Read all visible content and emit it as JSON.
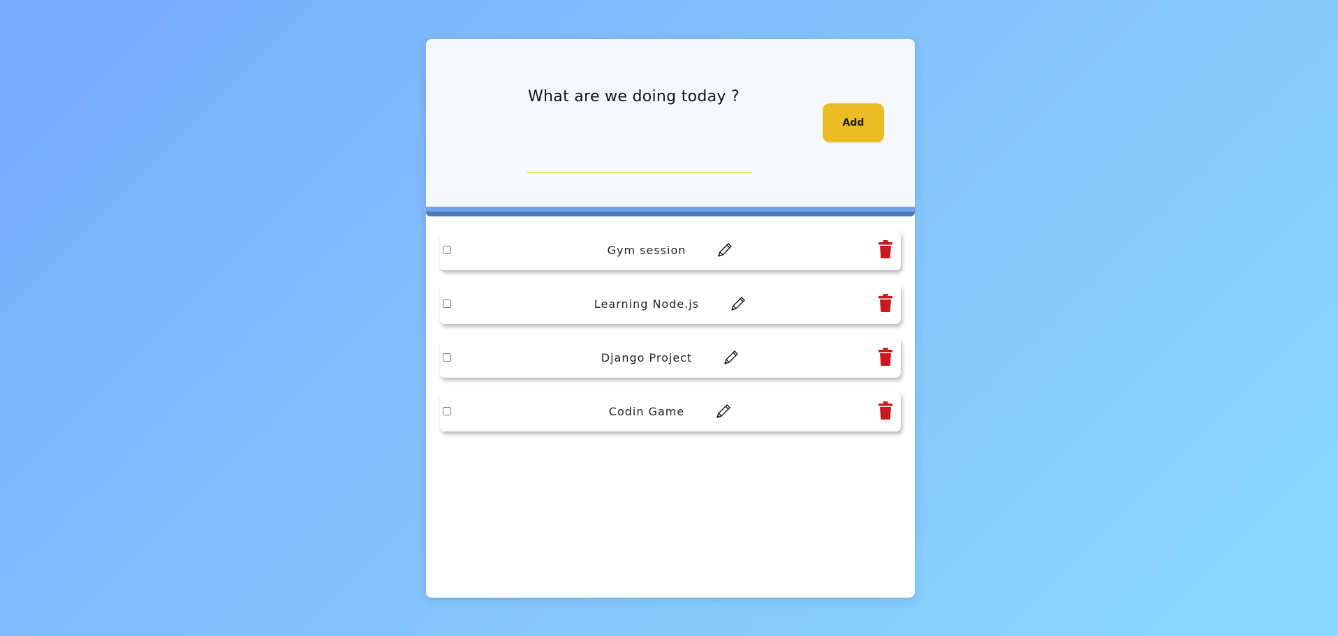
{
  "header": {
    "title": "What are we doing today ?",
    "input_value": "",
    "add_label": "Add"
  },
  "tasks": [
    {
      "text": "Gym session",
      "checked": false
    },
    {
      "text": "Learning Node.js",
      "checked": false
    },
    {
      "text": "Django Project",
      "checked": false
    },
    {
      "text": "Codin Game",
      "checked": false
    }
  ],
  "icons": {
    "edit": "pencil-icon",
    "delete": "trash-icon"
  },
  "colors": {
    "accent": "#ebbc25",
    "delete": "#c81a1e",
    "divider_light": "#71a4ec",
    "divider_dark": "#4f7ab4",
    "header_bg": "#f5f9fd"
  }
}
